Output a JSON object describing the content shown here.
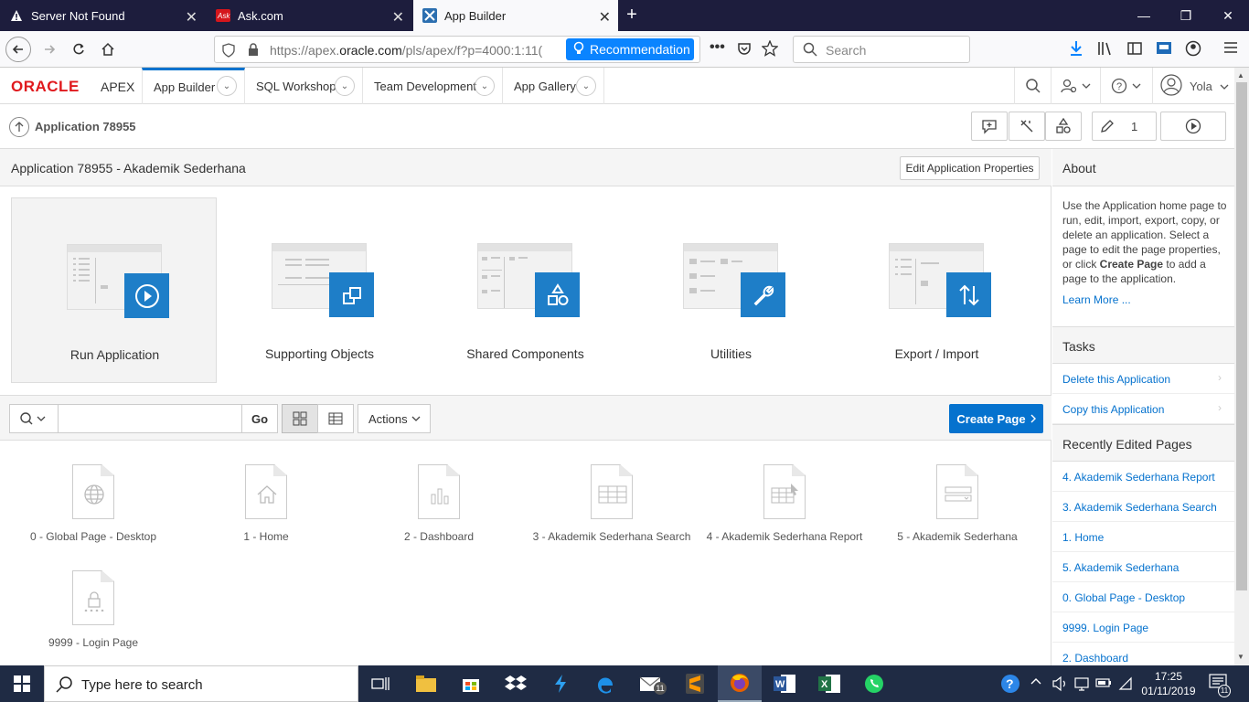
{
  "browser": {
    "tabs": [
      {
        "title": "Server Not Found",
        "icon": "warning-icon"
      },
      {
        "title": "Ask.com",
        "icon": "ask-logo-icon"
      },
      {
        "title": "App Builder",
        "icon": "apex-icon",
        "active": true
      }
    ],
    "url_prefix": "https://apex.",
    "url_domain": "oracle.com",
    "url_rest": "/pls/apex/f?p=4000:1:11(",
    "recommendation_label": "Recommendation",
    "search_placeholder": "Search"
  },
  "apex": {
    "logo_oracle": "ORACLE",
    "logo_apex": "APEX",
    "tabs": [
      "App Builder",
      "SQL Workshop",
      "Team Development",
      "App Gallery"
    ],
    "user": "Yola",
    "breadcrumb": "Application 78955",
    "edit_count": "1",
    "page_title": "Application 78955 - Akademik Sederhana",
    "edit_props_label": "Edit Application Properties",
    "cards": [
      {
        "label": "Run Application",
        "icon": "play-icon"
      },
      {
        "label": "Supporting Objects",
        "icon": "package-icon"
      },
      {
        "label": "Shared Components",
        "icon": "shapes-icon"
      },
      {
        "label": "Utilities",
        "icon": "wrench-icon"
      },
      {
        "label": "Export / Import",
        "icon": "up-down-arrows-icon"
      }
    ],
    "go_label": "Go",
    "actions_label": "Actions",
    "create_page_label": "Create Page",
    "pages": [
      {
        "label": "0 - Global Page - Desktop",
        "icon": "globe-icon"
      },
      {
        "label": "1 - Home",
        "icon": "home-icon"
      },
      {
        "label": "2 - Dashboard",
        "icon": "bar-chart-icon"
      },
      {
        "label": "3 - Akademik Sederhana Search",
        "icon": "table-icon"
      },
      {
        "label": "4 - Akademik Sederhana Report",
        "icon": "report-icon"
      },
      {
        "label": "5 - Akademik Sederhana",
        "icon": "form-icon"
      },
      {
        "label": "9999 - Login Page",
        "icon": "lock-icon"
      }
    ]
  },
  "sidebar": {
    "about_title": "About",
    "about_text_1": "Use the Application home page to run, edit, import, export, copy, or delete an application. Select a page to edit the page properties, or click ",
    "about_bold": "Create Page",
    "about_text_2": " to add a page to the application.",
    "learn_more": "Learn More ...",
    "tasks_title": "Tasks",
    "tasks": [
      "Delete this Application",
      "Copy this Application"
    ],
    "recent_title": "Recently Edited Pages",
    "recent": [
      "4. Akademik Sederhana Report",
      "3. Akademik Sederhana Search",
      "1. Home",
      "5. Akademik Sederhana",
      "0. Global Page - Desktop",
      "9999. Login Page",
      "2. Dashboard"
    ]
  },
  "taskbar": {
    "search_placeholder": "Type here to search",
    "time": "17:25",
    "date": "01/11/2019",
    "notif_count": "11",
    "mail_count": "11"
  }
}
